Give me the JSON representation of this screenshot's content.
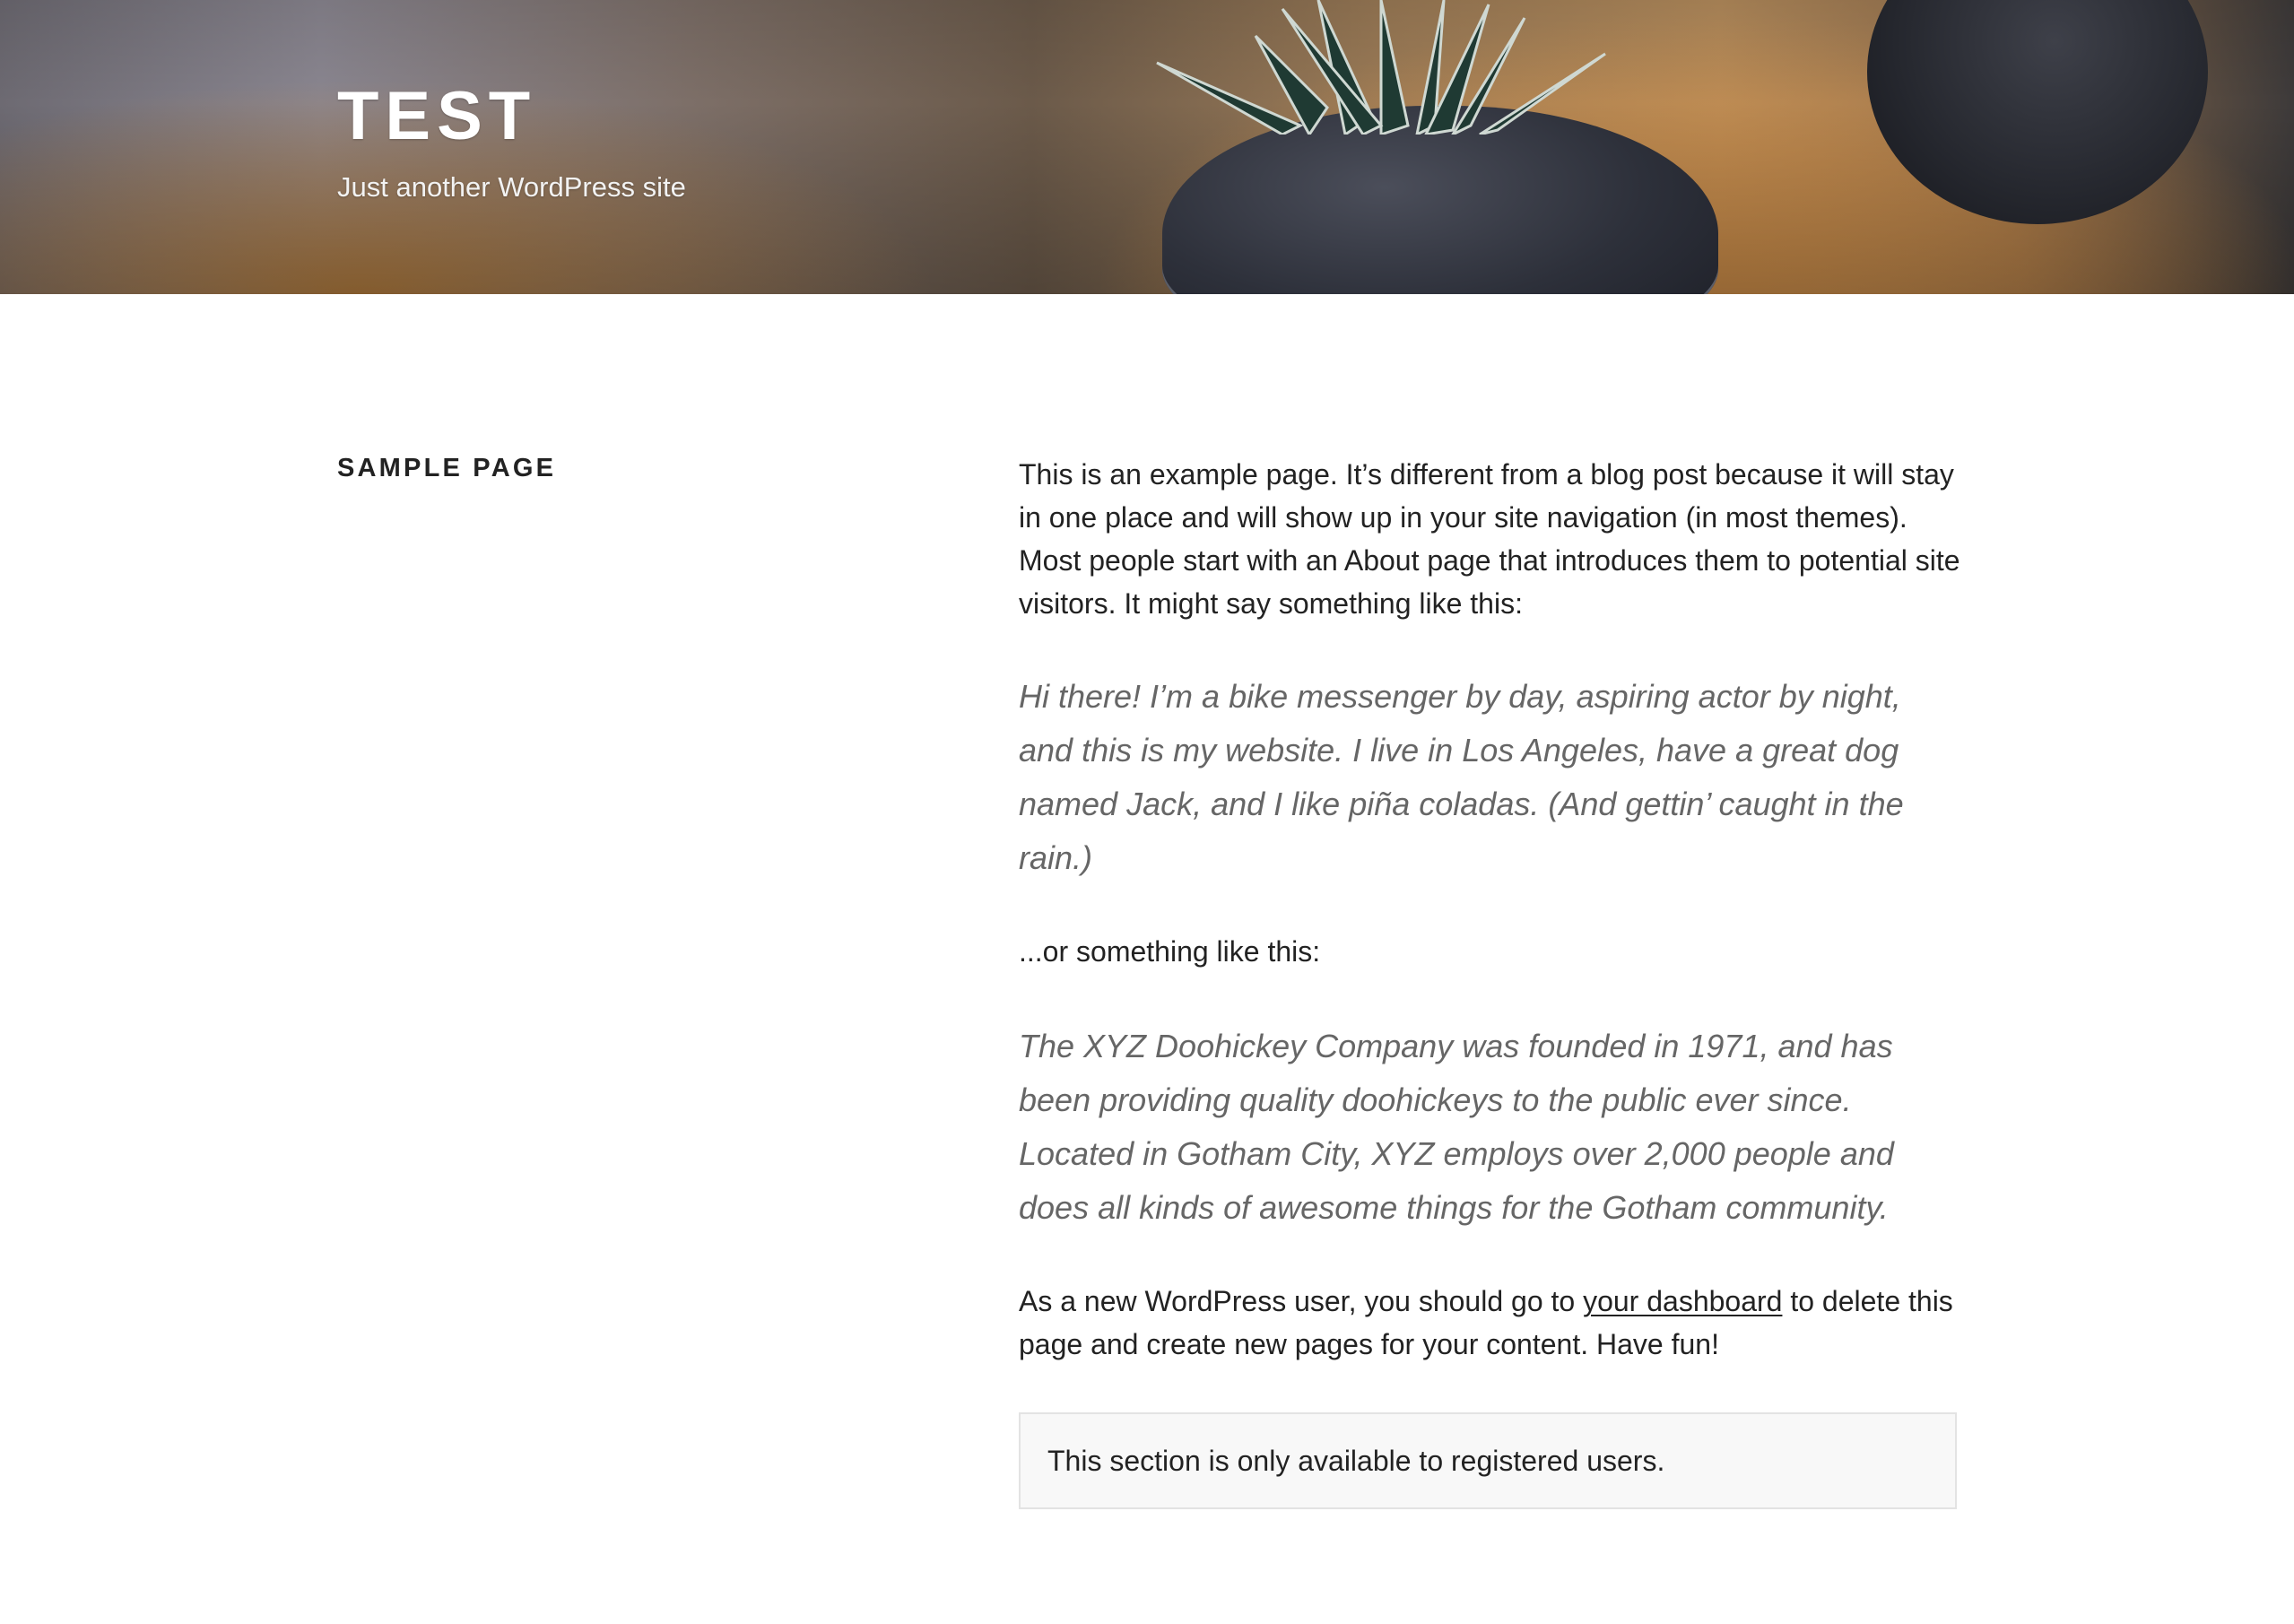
{
  "header": {
    "site_title": "TEST",
    "site_description": "Just another WordPress site",
    "image_icon": "succulent-plant-header-image"
  },
  "page": {
    "title": "SAMPLE PAGE"
  },
  "content": {
    "intro": "This is an example page. It’s different from a blog post because it will stay in one place and will show up in your site navigation (in most themes). Most people start with an About page that introduces them to potential site visitors. It might say something like this:",
    "quote1": "Hi there! I’m a bike messenger by day, aspiring actor by night, and this is my website. I live in Los Angeles, have a great dog named Jack, and I like piña coladas. (And gettin’ caught in the rain.)",
    "or_line": "...or something like this:",
    "quote2": "The XYZ Doohickey Company was founded in 1971, and has been providing quality doohickeys to the public ever since. Located in Gotham City, XYZ employs over 2,000 people and does all kinds of awesome things for the Gotham community.",
    "closing_before": "As a new WordPress user, you should go to ",
    "closing_link": "your dashboard",
    "closing_after": " to delete this page and create new pages for your content. Have fun!",
    "notice": "This section is only available to registered users."
  },
  "colors": {
    "text": "#222222",
    "quote_text": "#666666",
    "notice_bg": "#f8f8f8",
    "notice_border": "#e3e3e3",
    "header_text": "#ffffff"
  }
}
